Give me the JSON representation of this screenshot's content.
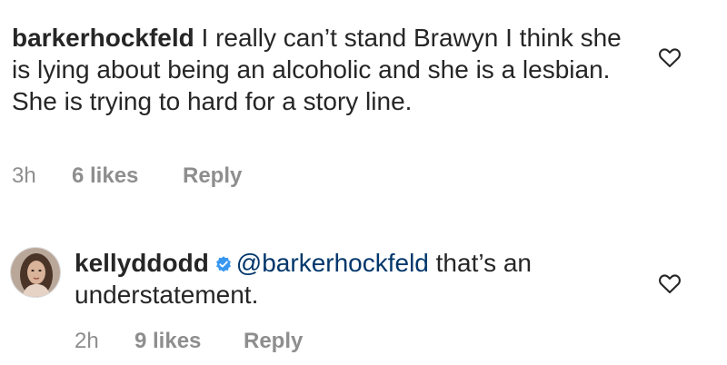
{
  "comments": [
    {
      "username": "barkerhockfeld",
      "text": "I really can’t stand Brawyn I think she is lying about being an alcoholic and she is a lesbian.  She is trying to hard for a story line.",
      "time": "3h",
      "likes": "6 likes",
      "reply": "Reply",
      "like_icon": "heart-outline-icon"
    },
    {
      "username": "kellyddodd",
      "verified": true,
      "mention": "@barkerhockfeld",
      "text": " that’s an understatement.",
      "time": "2h",
      "likes": "9 likes",
      "reply": "Reply",
      "like_icon": "heart-outline-icon",
      "verified_icon": "verified-badge-icon",
      "verified_color": "#3897f0"
    }
  ],
  "colors": {
    "text": "#262626",
    "meta": "#8e8e8e",
    "mention": "#00376b"
  }
}
